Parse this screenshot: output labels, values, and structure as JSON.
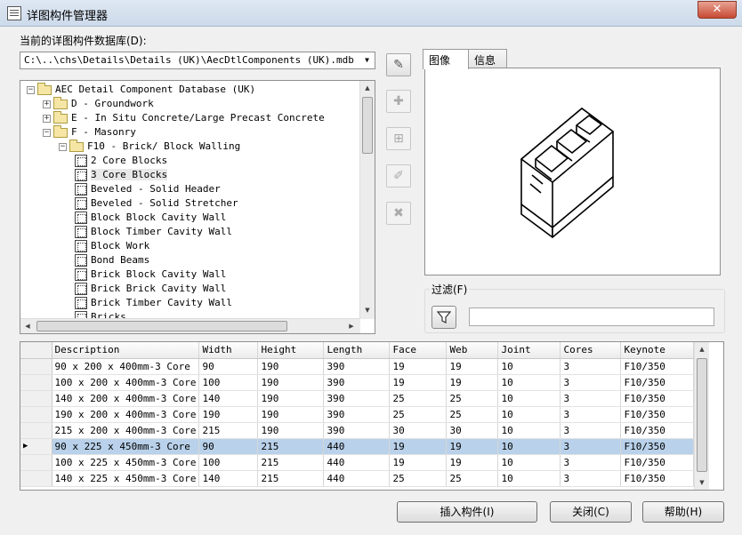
{
  "window": {
    "title": "详图构件管理器",
    "close_glyph": "✕"
  },
  "database": {
    "label": "当前的详图构件数据库(D):",
    "path": "C:\\..\\chs\\Details\\Details (UK)\\AecDtlComponents (UK).mdb"
  },
  "tree": {
    "items": [
      {
        "label": "AEC Detail Component Database (UK)",
        "level": 0,
        "kind": "folder",
        "expander": "minus"
      },
      {
        "label": "D - Groundwork",
        "level": 1,
        "kind": "folder",
        "expander": "plus"
      },
      {
        "label": "E - In Situ Concrete/Large Precast Concrete",
        "level": 1,
        "kind": "folder",
        "expander": "plus"
      },
      {
        "label": "F - Masonry",
        "level": 1,
        "kind": "folder",
        "expander": "minus"
      },
      {
        "label": "F10 - Brick/ Block Walling",
        "level": 2,
        "kind": "folder",
        "expander": "minus"
      },
      {
        "label": "2 Core Blocks",
        "level": 3,
        "kind": "component"
      },
      {
        "label": "3 Core Blocks",
        "level": 3,
        "kind": "component",
        "selected": true
      },
      {
        "label": "Beveled - Solid Header",
        "level": 3,
        "kind": "component"
      },
      {
        "label": "Beveled - Solid Stretcher",
        "level": 3,
        "kind": "component"
      },
      {
        "label": "Block Block Cavity Wall",
        "level": 3,
        "kind": "component"
      },
      {
        "label": "Block Timber Cavity Wall",
        "level": 3,
        "kind": "component"
      },
      {
        "label": "Block Work",
        "level": 3,
        "kind": "component"
      },
      {
        "label": "Bond Beams",
        "level": 3,
        "kind": "component"
      },
      {
        "label": "Brick Block Cavity Wall",
        "level": 3,
        "kind": "component"
      },
      {
        "label": "Brick Brick Cavity Wall",
        "level": 3,
        "kind": "component"
      },
      {
        "label": "Brick Timber Cavity Wall",
        "level": 3,
        "kind": "component"
      },
      {
        "label": "Bricks",
        "level": 3,
        "kind": "component"
      }
    ]
  },
  "toolbar": {
    "buttons": [
      {
        "name": "edit-database-button",
        "icon": "edit-document-icon",
        "glyph": "✎",
        "enabled": true
      },
      {
        "name": "new-folder-button",
        "icon": "new-folder-icon",
        "glyph": "✚",
        "enabled": false
      },
      {
        "name": "new-component-button",
        "icon": "new-component-icon",
        "glyph": "⊞",
        "enabled": false
      },
      {
        "name": "edit-component-button",
        "icon": "edit-component-icon",
        "glyph": "✐",
        "enabled": false
      },
      {
        "name": "delete-button",
        "icon": "delete-icon",
        "glyph": "✖",
        "enabled": false
      }
    ]
  },
  "tabs": [
    {
      "label": "图像",
      "active": true
    },
    {
      "label": "信息",
      "active": false
    }
  ],
  "filter": {
    "label": "过滤(F)",
    "value": "",
    "icon": "funnel-icon"
  },
  "grid": {
    "columns": [
      "Description",
      "Width",
      "Height",
      "Length",
      "Face",
      "Web",
      "Joint",
      "Cores",
      "Keynote"
    ],
    "rows": [
      [
        "90 x 200 x 400mm-3 Core",
        "90",
        "190",
        "390",
        "19",
        "19",
        "10",
        "3",
        "F10/350"
      ],
      [
        "100 x 200 x 400mm-3 Core",
        "100",
        "190",
        "390",
        "19",
        "19",
        "10",
        "3",
        "F10/350"
      ],
      [
        "140 x 200 x 400mm-3 Core",
        "140",
        "190",
        "390",
        "25",
        "25",
        "10",
        "3",
        "F10/350"
      ],
      [
        "190 x 200 x 400mm-3 Core",
        "190",
        "190",
        "390",
        "25",
        "25",
        "10",
        "3",
        "F10/350"
      ],
      [
        "215 x 200 x 400mm-3 Core",
        "215",
        "190",
        "390",
        "30",
        "30",
        "10",
        "3",
        "F10/350"
      ],
      [
        "90 x 225 x 450mm-3 Core",
        "90",
        "215",
        "440",
        "19",
        "19",
        "10",
        "3",
        "F10/350"
      ],
      [
        "100 x 225 x 450mm-3 Core",
        "100",
        "215",
        "440",
        "19",
        "19",
        "10",
        "3",
        "F10/350"
      ],
      [
        "140 x 225 x 450mm-3 Core",
        "140",
        "215",
        "440",
        "25",
        "25",
        "10",
        "3",
        "F10/350"
      ]
    ],
    "selected_row": 5,
    "current_row_marker": "▶"
  },
  "buttons": {
    "insert": "插入构件(I)",
    "close": "关闭(C)",
    "help": "帮助(H)"
  },
  "colors": {
    "selection": "#b9d1ea",
    "close_button": "#c74a32"
  }
}
